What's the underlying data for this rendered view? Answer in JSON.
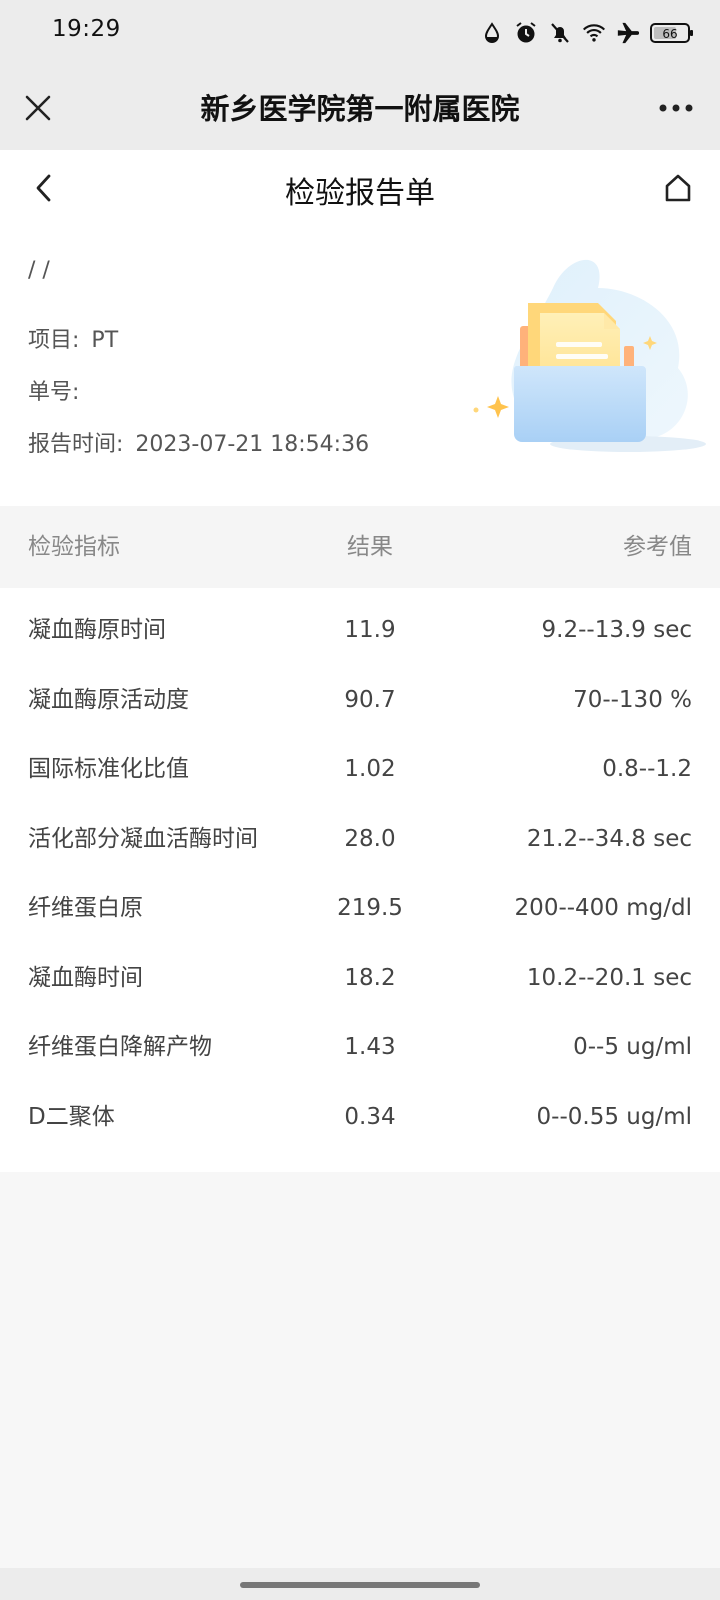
{
  "status_bar": {
    "time": "19:29",
    "battery": "66",
    "icons": [
      "water-drop-icon",
      "alarm-icon",
      "bell-off-icon",
      "wifi-icon",
      "airplane-icon",
      "battery-icon"
    ]
  },
  "webview": {
    "title": "新乡医学院第一附属医院"
  },
  "page": {
    "title": "检验报告单"
  },
  "info": {
    "patient": "/ /",
    "item_label": "项目:",
    "item_value": "PT",
    "number_label": "单号:",
    "number_value": "",
    "time_label": "报告时间:",
    "time_value": "2023-07-21 18:54:36"
  },
  "table": {
    "headers": {
      "name": "检验指标",
      "result": "结果",
      "reference": "参考值"
    },
    "rows": [
      {
        "name": "凝血酶原时间",
        "result": "11.9",
        "reference": "9.2--13.9 sec"
      },
      {
        "name": "凝血酶原活动度",
        "result": "90.7",
        "reference": "70--130 %"
      },
      {
        "name": "国际标准化比值",
        "result": "1.02",
        "reference": "0.8--1.2 "
      },
      {
        "name": "活化部分凝血活酶时间",
        "result": "28.0",
        "reference": "21.2--34.8 sec"
      },
      {
        "name": "纤维蛋白原",
        "result": "219.5",
        "reference": "200--400 mg/dl"
      },
      {
        "name": "凝血酶时间",
        "result": "18.2",
        "reference": "10.2--20.1 sec"
      },
      {
        "name": "纤维蛋白降解产物",
        "result": "1.43",
        "reference": "0--5 ug/ml"
      },
      {
        "name": "D二聚体",
        "result": "0.34",
        "reference": "0--0.55 ug/ml"
      }
    ]
  }
}
